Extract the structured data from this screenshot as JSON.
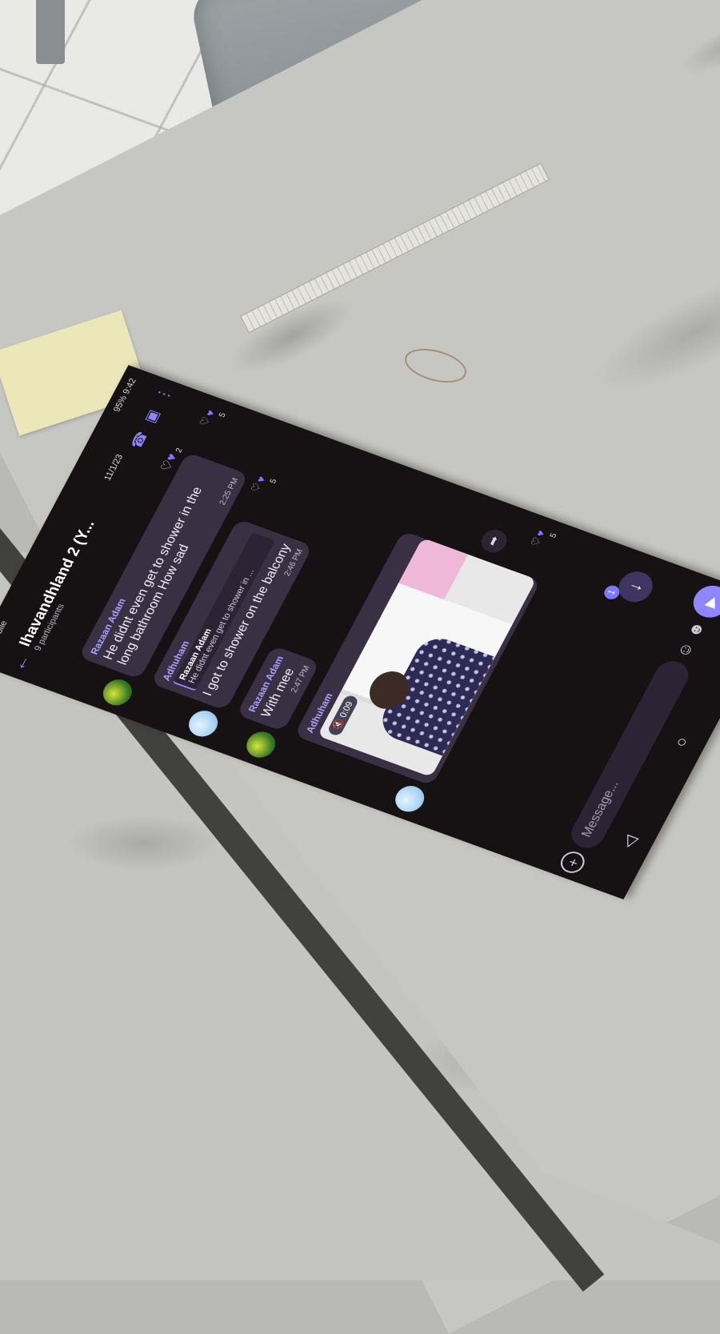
{
  "status_bar": {
    "carrier": "DhiMobile",
    "battery": "95%",
    "time": "9:42"
  },
  "chat": {
    "title": "Ihavandhland 2 (Y...",
    "participants": "9 participants",
    "date": "11/1/23"
  },
  "messages": [
    {
      "sender": "Razaan Adam",
      "text": "He didnt even get to shower in the long bathroom How sad",
      "time": "2:25 PM",
      "reactions": "5"
    },
    {
      "sender": "Adhuham",
      "reply_to_name": "Razaan Adam",
      "reply_to_text": "He didnt even get to shower in ...",
      "text": "I got to shower on the balcony",
      "time": "2:46 PM",
      "reactions": "5"
    },
    {
      "sender": "Razaan Adam",
      "text": "With mee",
      "time": "2:47 PM"
    },
    {
      "sender": "Adhuham",
      "video_duration": "0:09",
      "reactions": "5"
    }
  ],
  "top_reaction_count": "2",
  "unread_count": "1",
  "composer": {
    "placeholder": "Message..."
  },
  "icons": {
    "back": "arrow-left-icon",
    "call": "phone-icon",
    "video_call": "video-icon",
    "more": "more-vertical-icon",
    "heart_outline": "heart-outline-icon",
    "heart_filled": "heart-filled-icon",
    "share": "share-icon",
    "scroll_down": "arrow-down-icon",
    "plus": "plus-icon",
    "emoji": "emoji-icon",
    "sticker": "sticker-icon",
    "mic": "mic-icon",
    "nav_back": "triangle-back-icon",
    "nav_home": "circle-home-icon",
    "nav_recents": "square-recents-icon"
  },
  "colors": {
    "accent": "#8f86ff",
    "bubble": "#3a3044",
    "background": "#161112"
  }
}
